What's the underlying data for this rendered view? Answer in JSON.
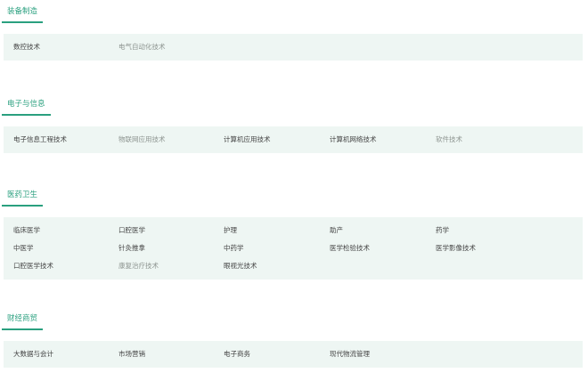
{
  "categories": [
    {
      "title": "装备制造",
      "rows": [
        [
          {
            "label": "数控技术",
            "muted": false
          },
          {
            "label": "电气自动化技术",
            "muted": true
          }
        ]
      ]
    },
    {
      "title": "电子与信息",
      "rows": [
        [
          {
            "label": "电子信息工程技术",
            "muted": false
          },
          {
            "label": "物联网应用技术",
            "muted": true
          },
          {
            "label": "计算机应用技术",
            "muted": false
          },
          {
            "label": "计算机网络技术",
            "muted": false
          },
          {
            "label": "软件技术",
            "muted": true
          }
        ]
      ]
    },
    {
      "title": "医药卫生",
      "rows": [
        [
          {
            "label": "临床医学",
            "muted": false
          },
          {
            "label": "口腔医学",
            "muted": false
          },
          {
            "label": "护理",
            "muted": false
          },
          {
            "label": "助产",
            "muted": false
          },
          {
            "label": "药学",
            "muted": false
          }
        ],
        [
          {
            "label": "中医学",
            "muted": false
          },
          {
            "label": "针灸推拿",
            "muted": false
          },
          {
            "label": "中药学",
            "muted": false
          },
          {
            "label": "医学检验技术",
            "muted": false
          },
          {
            "label": "医学影像技术",
            "muted": false
          }
        ],
        [
          {
            "label": "口腔医学技术",
            "muted": false
          },
          {
            "label": "康复治疗技术",
            "muted": true
          },
          {
            "label": "眼视光技术",
            "muted": false
          }
        ]
      ]
    },
    {
      "title": "财经商贸",
      "rows": [
        [
          {
            "label": "大数据与会计",
            "muted": false
          },
          {
            "label": "市场营销",
            "muted": false
          },
          {
            "label": "电子商务",
            "muted": false
          },
          {
            "label": "现代物流管理",
            "muted": false
          }
        ]
      ]
    }
  ],
  "colors": {
    "accent": "#2aa07f",
    "panel_bg": "#eef6f3",
    "text": "#444444",
    "muted_text": "#8d9490"
  }
}
